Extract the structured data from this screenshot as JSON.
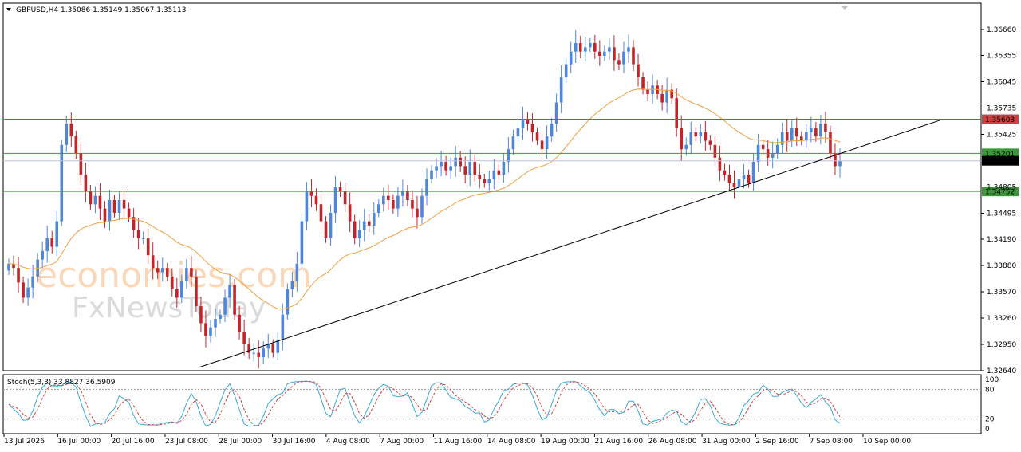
{
  "header": {
    "symbol_line": "GBPUSD,H4  1.35086 1.35149 1.35067 1.35113",
    "stoch_line": "Stoch(5,3,3) 33.8827 36.5909"
  },
  "watermark": {
    "line1": "economies.com",
    "line2": "FxNewsToday"
  },
  "colors": {
    "bull": "#4f86d9",
    "bear": "#c0252b",
    "ma": "#f0a040",
    "resistance": "#d04040",
    "support": "#3a9a3a",
    "trend": "#000000",
    "bid": "#b9c0e8",
    "stoch_main": "#3aa8d8",
    "stoch_signal": "#d04040"
  },
  "chart_data": {
    "type": "candlestick",
    "symbol": "GBPUSD",
    "timeframe": "H4",
    "ohlc_current": {
      "open": 1.35086,
      "high": 1.35149,
      "low": 1.35067,
      "close": 1.35113
    },
    "ylim": [
      1.3264,
      1.3697
    ],
    "y_ticks": [
      "1.36660",
      "1.36355",
      "1.36045",
      "1.35735",
      "1.35425",
      "1.34805",
      "1.34495",
      "1.34190",
      "1.33880",
      "1.33570",
      "1.33260",
      "1.32950",
      "1.32640"
    ],
    "x_ticks": [
      "13 Jul 2026",
      "16 Jul 00:00",
      "20 Jul 16:00",
      "23 Jul 08:00",
      "28 Jul 00:00",
      "30 Jul 16:00",
      "4 Aug 08:00",
      "7 Aug 00:00",
      "11 Aug 16:00",
      "14 Aug 08:00",
      "19 Aug 00:00",
      "21 Aug 16:00",
      "26 Aug 08:00",
      "31 Aug 00:00",
      "2 Sep 16:00",
      "7 Sep 08:00",
      "10 Sep 00:00"
    ],
    "horizontal_levels": [
      {
        "value": 1.35603,
        "label": "1.35603",
        "kind": "resistance"
      },
      {
        "value": 1.35201,
        "label": "1.35201",
        "kind": "support"
      },
      {
        "value": 1.35113,
        "label": "1.35113",
        "kind": "bid"
      },
      {
        "value": 1.34752,
        "label": "1.34752",
        "kind": "support"
      }
    ],
    "trendline": {
      "from": {
        "bar": 0.19,
        "price": 1.3268
      },
      "to": {
        "bar": 0.92,
        "price": 1.3559
      }
    },
    "closes": [
      1.339,
      1.3385,
      1.3368,
      1.335,
      1.3362,
      1.3375,
      1.3395,
      1.3405,
      1.342,
      1.341,
      1.344,
      1.353,
      1.3555,
      1.354,
      1.352,
      1.3495,
      1.3475,
      1.346,
      1.347,
      1.3455,
      1.344,
      1.3465,
      1.345,
      1.3465,
      1.3455,
      1.3445,
      1.343,
      1.342,
      1.342,
      1.34,
      1.3385,
      1.338,
      1.3385,
      1.3375,
      1.336,
      1.335,
      1.337,
      1.3385,
      1.3375,
      1.334,
      1.332,
      1.3305,
      1.3315,
      1.3325,
      1.333,
      1.335,
      1.3365,
      1.333,
      1.331,
      1.3295,
      1.3285,
      1.3285,
      1.328,
      1.329,
      1.3295,
      1.3285,
      1.33,
      1.333,
      1.336,
      1.337,
      1.339,
      1.344,
      1.3475,
      1.347,
      1.346,
      1.344,
      1.342,
      1.345,
      1.348,
      1.3475,
      1.346,
      1.344,
      1.342,
      1.343,
      1.344,
      1.3435,
      1.345,
      1.346,
      1.347,
      1.3465,
      1.3455,
      1.347,
      1.3475,
      1.3465,
      1.3455,
      1.3445,
      1.347,
      1.349,
      1.35,
      1.3505,
      1.351,
      1.35,
      1.3505,
      1.3515,
      1.3505,
      1.3495,
      1.351,
      1.3495,
      1.349,
      1.3485,
      1.349,
      1.35,
      1.3495,
      1.351,
      1.3525,
      1.354,
      1.355,
      1.356,
      1.3555,
      1.3545,
      1.3535,
      1.3525,
      1.354,
      1.3555,
      1.358,
      1.361,
      1.3625,
      1.364,
      1.365,
      1.364,
      1.3645,
      1.365,
      1.364,
      1.3635,
      1.364,
      1.3645,
      1.363,
      1.3625,
      1.364,
      1.3645,
      1.3625,
      1.361,
      1.3595,
      1.359,
      1.36,
      1.359,
      1.358,
      1.3595,
      1.3585,
      1.355,
      1.3525,
      1.353,
      1.3545,
      1.354,
      1.3545,
      1.3535,
      1.353,
      1.3515,
      1.35,
      1.3495,
      1.3485,
      1.348,
      1.349,
      1.3495,
      1.3485,
      1.351,
      1.353,
      1.3525,
      1.3515,
      1.352,
      1.353,
      1.3545,
      1.3535,
      1.355,
      1.354,
      1.3535,
      1.3545,
      1.355,
      1.354,
      1.3555,
      1.3545,
      1.352,
      1.3505,
      1.3511
    ],
    "ma_series_name": "",
    "stochastic": {
      "name": "Stoch(5,3,3)",
      "main_value": 33.8827,
      "signal_value": 36.5909,
      "levels": [
        80,
        20
      ],
      "scale": [
        "100",
        "80",
        "20",
        "0"
      ],
      "ylim": [
        0,
        100
      ]
    }
  }
}
